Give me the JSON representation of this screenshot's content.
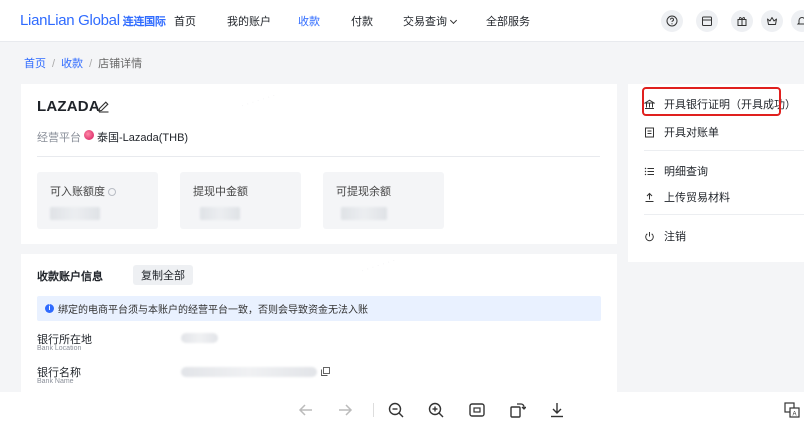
{
  "header": {
    "logo_text": "LianLian Global",
    "logo_cn": "连连国际",
    "nav": [
      {
        "label": "首页"
      },
      {
        "label": "我的账户"
      },
      {
        "label": "收款",
        "active": true
      },
      {
        "label": "付款"
      },
      {
        "label": "交易查询"
      },
      {
        "label": "全部服务"
      }
    ],
    "icons": [
      "help-icon",
      "calendar-icon",
      "gift-icon",
      "crown-icon",
      "notification-icon"
    ],
    "accent": "#2f6bff"
  },
  "breadcrumb": [
    "首页",
    "收款",
    "店铺详情"
  ],
  "store": {
    "name": "LAZADA",
    "platform_label": "经营平台",
    "platform_value": "泰国-Lazada(THB)",
    "stats": [
      {
        "label": "可入账额度"
      },
      {
        "label": "提现中金额"
      },
      {
        "label": "可提现余额"
      }
    ]
  },
  "account_info": {
    "title": "收款账户信息",
    "copy_all": "复制全部",
    "notice": "绑定的电商平台须与本账户的经营平台一致，否则会导致资金无法入账",
    "fields": [
      {
        "label": "银行所在地",
        "sub": "Bank Location"
      },
      {
        "label": "银行名称",
        "sub": "Bank Name"
      }
    ]
  },
  "side_menu": {
    "items": [
      {
        "label": "开具银行证明（开具成功）",
        "icon": "bank-icon"
      },
      {
        "label": "开具对账单",
        "icon": "document-icon"
      },
      {
        "label": "明细查询",
        "icon": "list-icon"
      },
      {
        "label": "上传贸易材料",
        "icon": "upload-icon"
      },
      {
        "label": "注销",
        "icon": "power-icon"
      }
    ],
    "highlight_color": "#e0201e"
  },
  "viewer_toolbar": {
    "icons": [
      "back-arrow-icon",
      "forward-arrow-icon",
      "zoom-out-icon",
      "zoom-in-icon",
      "fit-screen-icon",
      "rotate-icon",
      "download-icon",
      "translate-icon"
    ]
  }
}
